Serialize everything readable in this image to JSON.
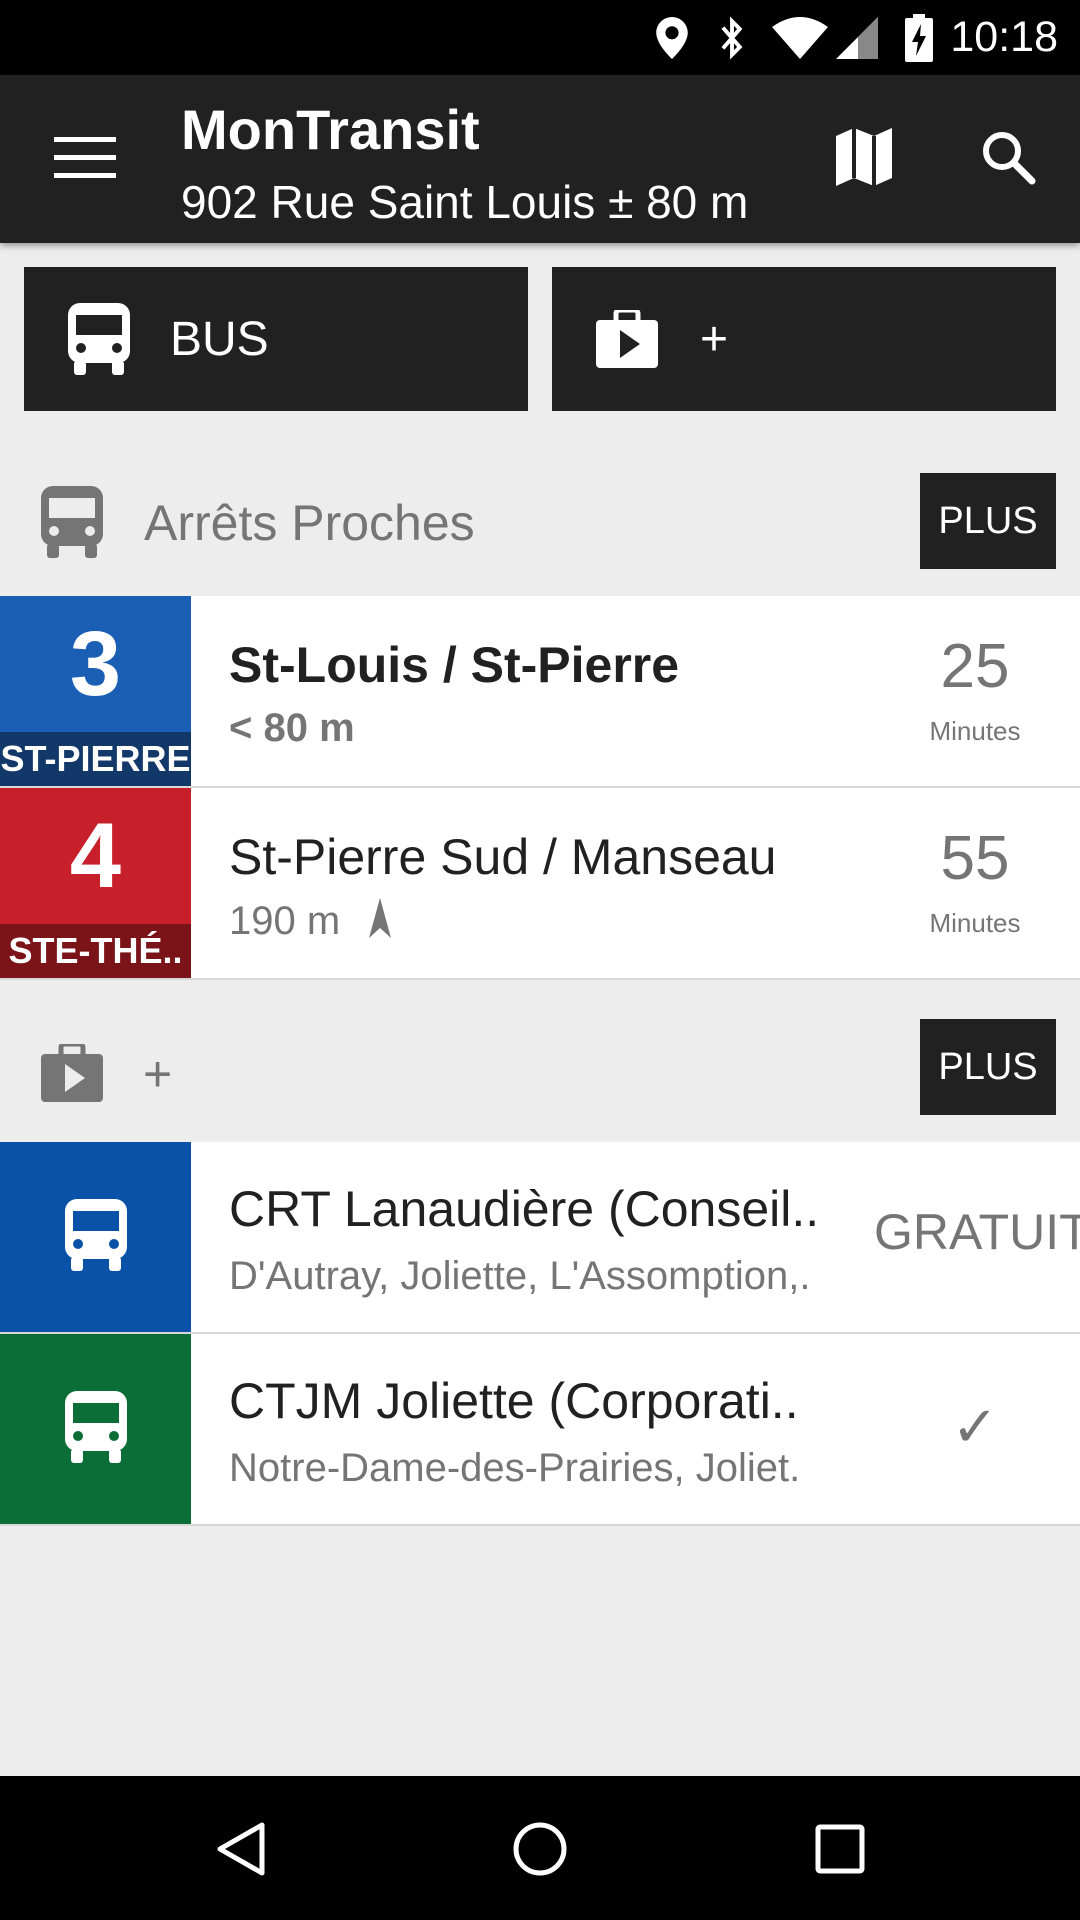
{
  "status_bar": {
    "time": "10:18",
    "icons": [
      "location-icon",
      "bluetooth-icon",
      "wifi-icon",
      "signal-icon",
      "battery-charging-icon"
    ]
  },
  "toolbar": {
    "title": "MonTransit",
    "subtitle": "902 Rue Saint Louis ± 80 m",
    "menu_icon": "hamburger-menu-icon",
    "map_icon": "map-icon",
    "search_icon": "search-icon"
  },
  "modules": [
    {
      "label": "BUS",
      "icon": "bus-icon"
    },
    {
      "label": "+",
      "icon": "store-bag-icon"
    }
  ],
  "nearby": {
    "title": "Arrêts Proches",
    "more_label": "PLUS",
    "stops": [
      {
        "route": "3",
        "headsign": "ST-PIERRE",
        "color": "#1a5fb4",
        "head_color": "#12386a",
        "name": "St-Louis / St-Pierre",
        "distance": "< 80 m",
        "time_value": "25",
        "time_unit": "Minutes"
      },
      {
        "route": "4",
        "headsign": "STE-THÉ..",
        "color": "#c7202a",
        "head_color": "#7a1418",
        "name": "St-Pierre Sud / Manseau",
        "distance": "190 m",
        "time_value": "55",
        "time_unit": "Minutes"
      }
    ]
  },
  "store": {
    "title": "+",
    "more_label": "PLUS",
    "agencies": [
      {
        "name": "CRT Lanaudière (Conseil..",
        "areas": "D'Autray, Joliette, L'Assomption,.",
        "status": "GRATUIT",
        "color": "#0a51a8"
      },
      {
        "name": "CTJM Joliette (Corporati..",
        "areas": "Notre-Dame-des-Prairies, Joliet.",
        "status": "✓",
        "color": "#0a6e36"
      }
    ]
  },
  "nav_bar": {
    "back_icon": "back-icon",
    "home_icon": "home-icon",
    "recents_icon": "recents-icon"
  }
}
